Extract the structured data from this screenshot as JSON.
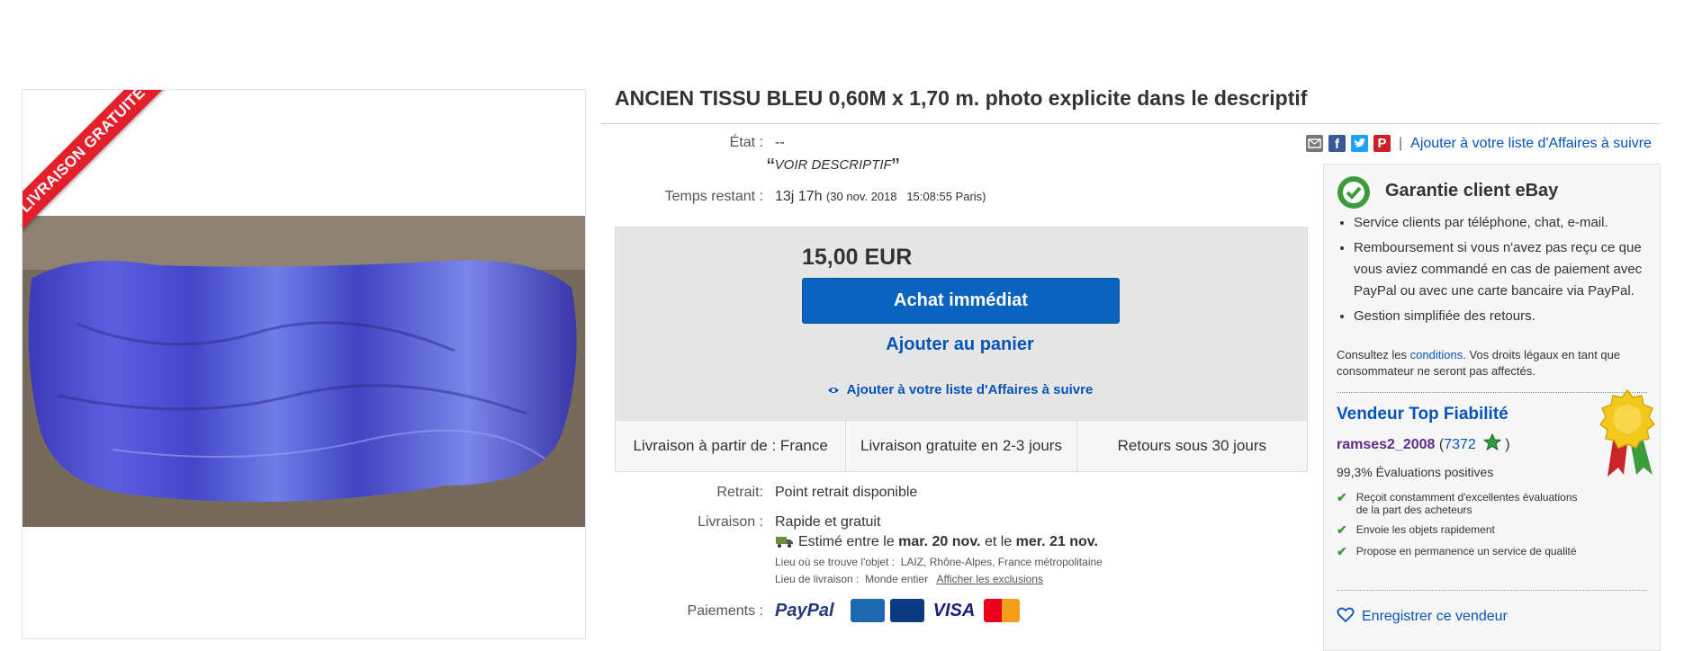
{
  "image": {
    "ribbon_text": "LIVRAISON GRATUITE"
  },
  "title": "ANCIEN TISSU BLEU 0,60M x 1,70 m. photo explicite dans le descriptif",
  "share": {
    "watch_link": "Ajouter à votre liste d'Affaires à suivre",
    "separator": "|"
  },
  "details": {
    "state_label": "État :",
    "state_value": "--",
    "state_desc": "VOIR DESCRIPTIF",
    "time_label": "Temps restant :",
    "time_value": "13j 17h",
    "time_end": "(30 nov. 2018   15:08:55 Paris)"
  },
  "buy": {
    "price": "15,00 EUR",
    "buy_now": "Achat immédiat",
    "add_cart": "Ajouter au panier",
    "add_watch": "Ajouter à votre liste d'Affaires à suivre"
  },
  "shipping_row": [
    "Livraison à partir de : France",
    "Livraison gratuite en 2-3 jours",
    "Retours sous 30 jours"
  ],
  "pickup": {
    "label": "Retrait:",
    "value": "Point retrait disponible"
  },
  "delivery": {
    "label": "Livraison :",
    "value": "Rapide et gratuit",
    "estimate_prefix": "Estimé entre le",
    "date1": "mar. 20 nov.",
    "estimate_mid": "et le",
    "date2": "mer. 21 nov.",
    "item_location_label": "Lieu où se trouve l'objet :",
    "item_location": "LAIZ, Rhône-Alpes, France métropolitaine",
    "ship_to_label": "Lieu de livraison :",
    "ship_to": "Monde entier",
    "exclusions_link": "Afficher les exclusions"
  },
  "payments": {
    "label": "Paiements :",
    "paypal": "PayPal",
    "visa": "VISA"
  },
  "guarantee": {
    "title": "Garantie client eBay",
    "bullets": [
      "Service clients par téléphone, chat, e-mail.",
      "Remboursement si vous n'avez pas reçu ce que vous aviez commandé en cas de paiement avec PayPal ou avec une carte bancaire via PayPal.",
      "Gestion simplifiée des retours."
    ],
    "consult_prefix": "Consultez les",
    "conditions_link": "conditions",
    "consult_suffix": ". Vos droits légaux en tant que consommateur ne seront pas affectés."
  },
  "seller": {
    "badge_title": "Vendeur Top Fiabilité",
    "name": "ramses2_2008",
    "score_open": "(",
    "score": "7372",
    "score_close": ")",
    "positive": "99,3% Évaluations positives",
    "points": [
      "Reçoit constamment d'excellentes évaluations de la part des acheteurs",
      "Envoie les objets rapidement",
      "Propose en permanence un service de qualité"
    ],
    "save_seller": "Enregistrer ce vendeur"
  },
  "colors": {
    "accent_blue": "#0654ba",
    "buy_button": "#0a63bf",
    "ribbon_red": "#e41e2b",
    "seller_name": "#5a2d8c",
    "check_green": "#3c9c3c"
  }
}
